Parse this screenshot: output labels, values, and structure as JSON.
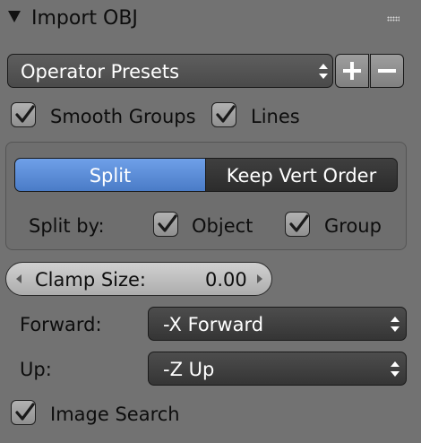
{
  "panel": {
    "title": "Import OBJ"
  },
  "presets": {
    "label": "Operator Presets",
    "add_label": "+",
    "remove_label": "−"
  },
  "options": {
    "smooth_groups": {
      "label": "Smooth Groups",
      "checked": true
    },
    "lines": {
      "label": "Lines",
      "checked": true
    }
  },
  "split_mode": {
    "options": [
      "Split",
      "Keep Vert Order"
    ],
    "selected": "Split",
    "split_by_label": "Split by:",
    "object": {
      "label": "Object",
      "checked": true
    },
    "group": {
      "label": "Group",
      "checked": true
    }
  },
  "clamp": {
    "label": "Clamp Size:",
    "value": "0.00"
  },
  "axis": {
    "forward_label": "Forward:",
    "forward_value": "-X Forward",
    "up_label": "Up:",
    "up_value": "-Z Up"
  },
  "image_search": {
    "label": "Image Search",
    "checked": true
  },
  "colors": {
    "accent": "#5b8ad6",
    "background": "#727272",
    "dropdown": "#404040"
  }
}
